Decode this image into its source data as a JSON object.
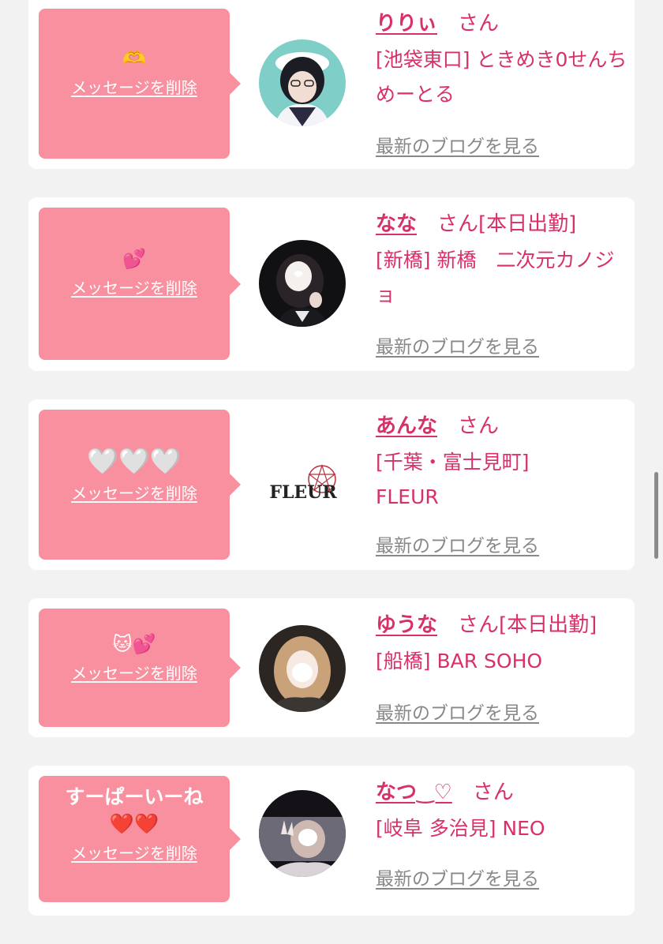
{
  "favorites": [
    {
      "message": "🫶",
      "message_kind": "emoji",
      "delete_label": "メッセージを削除",
      "name": "りりぃ",
      "honorific": "さん",
      "status": "",
      "shop": "[池袋東口] ときめき0せんちめーとる",
      "blog_label": "最新のブログを見る",
      "avatar": "maid-girl-photo"
    },
    {
      "message": "💕",
      "message_kind": "emoji",
      "delete_label": "メッセージを削除",
      "name": "なな",
      "honorific": "さん",
      "status": "[本日出勤]",
      "shop": "[新橋] 新橋　二次元カノジョ",
      "blog_label": "最新のブログを見る",
      "avatar": "girl-photo-dark"
    },
    {
      "message": "🤍🤍🤍",
      "message_kind": "emoji",
      "delete_label": "メッセージを削除",
      "name": "あんな",
      "honorific": "さん",
      "status": "",
      "shop": "[千葉・富士見町] FLEUR",
      "blog_label": "最新のブログを見る",
      "avatar": "fleur-logo",
      "avatar_text": "FLEUR"
    },
    {
      "message": "🐱💕",
      "message_kind": "emoji",
      "delete_label": "メッセージを削除",
      "name": "ゆうな",
      "honorific": "さん",
      "status": "[本日出勤]",
      "shop": "[船橋] BAR SOHO",
      "blog_label": "最新のブログを見る",
      "avatar": "girl-photo-blonde"
    },
    {
      "message": "すーぱーいーね\n❤️❤️",
      "message_kind": "text",
      "delete_label": "メッセージを削除",
      "name": "なつ‿♡",
      "honorific": "さん",
      "status": "",
      "shop": "[岐阜 多治見] NEO",
      "blog_label": "最新のブログを見る",
      "avatar": "girl-photo-peace"
    }
  ],
  "colors": {
    "accent": "#d8306a",
    "bubble": "#f9909f",
    "background": "#f2f2f2",
    "link_gray": "#888888"
  }
}
